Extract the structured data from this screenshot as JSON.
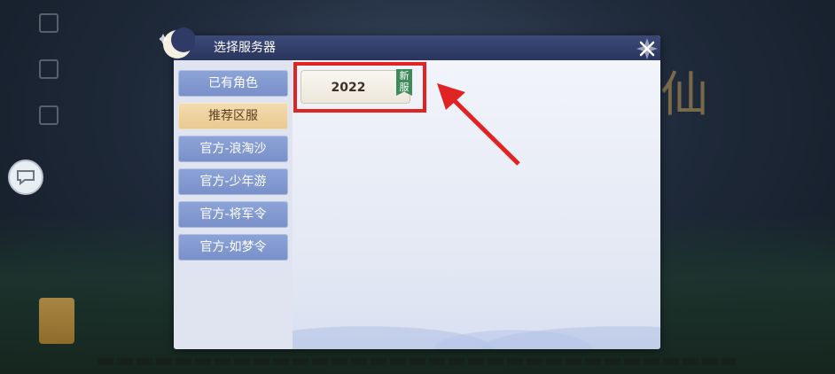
{
  "dialog": {
    "title": "选择服务器",
    "tabs": [
      {
        "label": "已有角色",
        "selected": false
      },
      {
        "label": "推荐区服",
        "selected": true
      },
      {
        "label": "官方-浪淘沙",
        "selected": false
      },
      {
        "label": "官方-少年游",
        "selected": false
      },
      {
        "label": "官方-将军令",
        "selected": false
      },
      {
        "label": "官方-如梦令",
        "selected": false
      }
    ],
    "servers": [
      {
        "name": "2022",
        "badge": "新服"
      }
    ]
  },
  "annotation": {
    "highlight_color": "#e02424"
  },
  "background": {
    "title_art": "仙"
  }
}
